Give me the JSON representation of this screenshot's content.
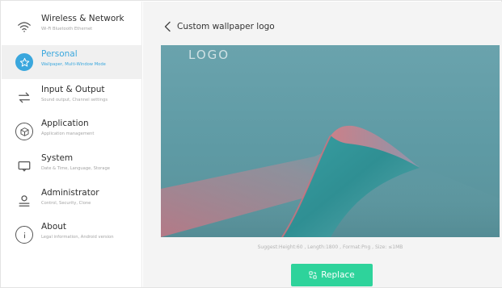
{
  "sidebar": {
    "items": [
      {
        "title": "Wireless & Network",
        "subtitle": "Wi-Fi Bluetooth Ethernet",
        "icon": "wifi-icon"
      },
      {
        "title": "Personal",
        "subtitle": "Wallpaper, Multi-Window Mode",
        "icon": "star-icon",
        "active": true
      },
      {
        "title": "Input & Output",
        "subtitle": "Sound output, Channel settings",
        "icon": "swap-arrows-icon"
      },
      {
        "title": "Application",
        "subtitle": "Application management",
        "icon": "cube-icon"
      },
      {
        "title": "System",
        "subtitle": "Date & Time, Language, Storage",
        "icon": "monitor-icon"
      },
      {
        "title": "Administrator",
        "subtitle": "Control, Security, Clone",
        "icon": "user-icon"
      },
      {
        "title": "About",
        "subtitle": "Legal information, Android version",
        "icon": "info-icon"
      }
    ]
  },
  "header": {
    "title": "Custom wallpaper logo"
  },
  "preview": {
    "logo_text": "LOGO"
  },
  "hint": "Suggest:Height:60 , Length:1800 , Format:Png , Size: ≤1MB",
  "replace_label": "Replace",
  "colors": {
    "accent": "#3aa7dd",
    "replace_button": "#2ed39b",
    "background": "#f4f4f4"
  }
}
